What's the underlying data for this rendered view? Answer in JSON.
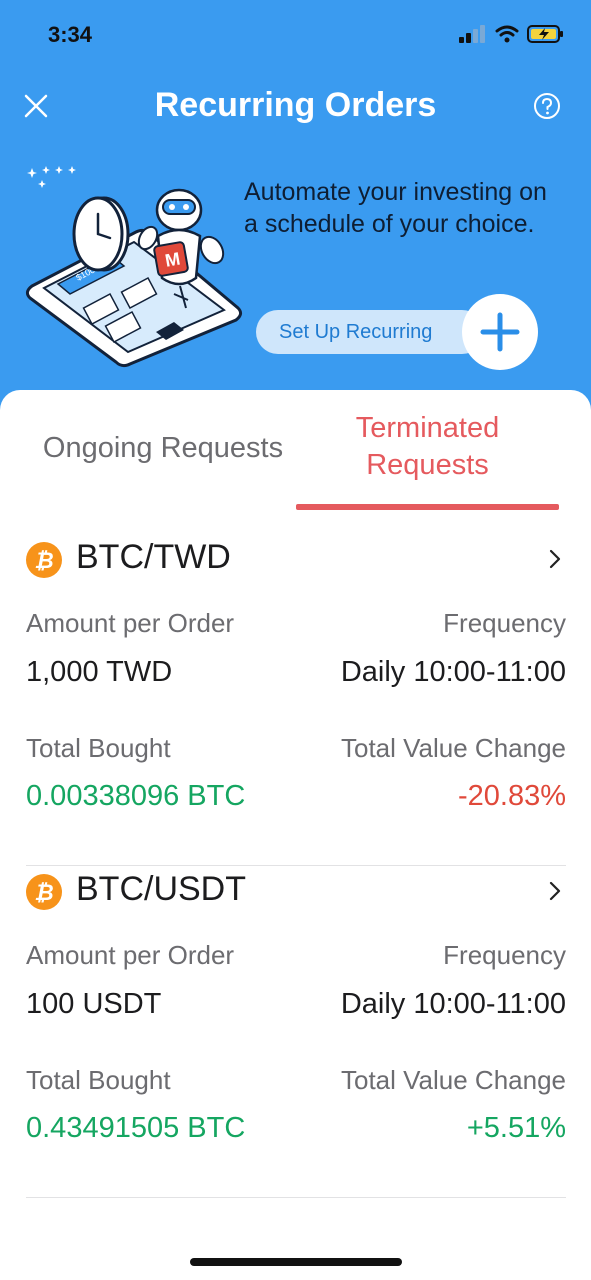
{
  "status_bar": {
    "time": "3:34"
  },
  "nav": {
    "title": "Recurring Orders"
  },
  "hero": {
    "text": "Automate your investing on a schedule of your choice.",
    "setup_label": "Set Up Recurring",
    "illustration_amount": "$1000",
    "robot_letter": "M"
  },
  "tabs": [
    {
      "label": "Ongoing Requests",
      "active": false
    },
    {
      "label": "Terminated Requests",
      "active": true
    }
  ],
  "orders": [
    {
      "pair": "BTC/TWD",
      "amount_label": "Amount per Order",
      "amount_value": "1,000 TWD",
      "frequency_label": "Frequency",
      "frequency_value": "Daily 10:00-11:00",
      "bought_label": "Total Bought",
      "bought_value": "0.00338096 BTC",
      "change_label": "Total Value Change",
      "change_value": "-20.83%"
    },
    {
      "pair": "BTC/USDT",
      "amount_label": "Amount per Order",
      "amount_value": "100 USDT",
      "frequency_label": "Frequency",
      "frequency_value": "Daily 10:00-11:00",
      "bought_label": "Total Bought",
      "bought_value": "0.43491505 BTC",
      "change_label": "Total Value Change",
      "change_value": "+5.51%"
    }
  ],
  "icons": {
    "close": "close-icon",
    "help": "help-icon",
    "plus": "plus-icon",
    "coin": "bitcoin-icon",
    "chevron": "chevron-right-icon"
  },
  "colors": {
    "header_bg": "#3a9bf0",
    "accent_red": "#e55a5e",
    "positive": "#15a661",
    "negative": "#e0493a",
    "bitcoin": "#f7931a"
  }
}
